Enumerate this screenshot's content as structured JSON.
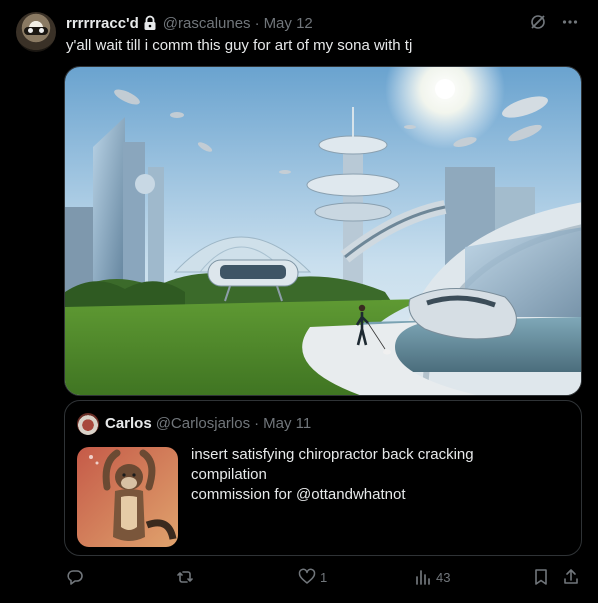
{
  "post": {
    "author": {
      "display_name": "rrrrrracc'd",
      "handle": "@rascalunes",
      "date": "May 12",
      "protected_icon": "lock-icon"
    },
    "text": "y'all wait till i comm this guy for art of my sona with tj",
    "header_icons": [
      "grok-icon",
      "more-icon"
    ],
    "media": {
      "icon": "image"
    },
    "quote": {
      "author": {
        "display_name": "Carlos",
        "handle": "@Carlosjarlos",
        "date": "May 11"
      },
      "lines": [
        "insert satisfying chiropractor back cracking",
        "compilation",
        "commission for @ottandwhatnot"
      ]
    },
    "actions": {
      "reply": {
        "icon": "reply-icon"
      },
      "repost": {
        "icon": "repost-icon"
      },
      "like": {
        "icon": "heart-icon",
        "count": "1"
      },
      "views": {
        "icon": "views-icon",
        "count": "43"
      },
      "bookmark": {
        "icon": "bookmark-icon"
      },
      "share": {
        "icon": "share-icon"
      }
    },
    "separator": "·"
  }
}
